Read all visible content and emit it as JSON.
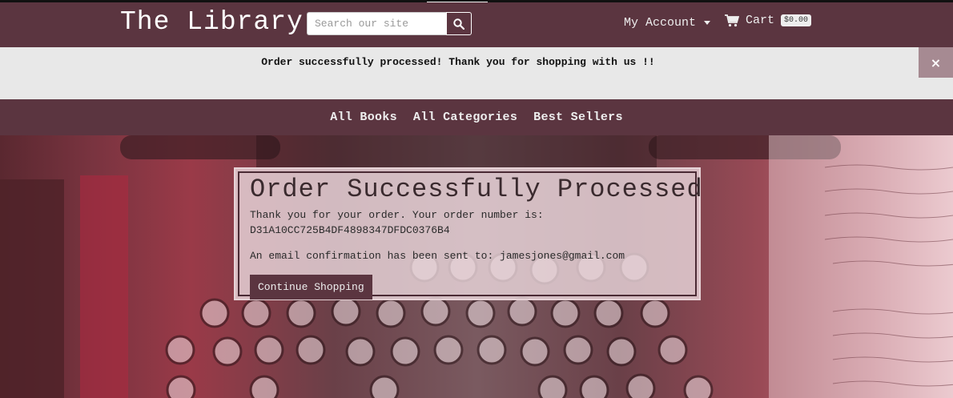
{
  "header": {
    "brand": "The Library",
    "search_placeholder": "Search our site",
    "account_label": "My Account",
    "cart_label": "Cart",
    "cart_total": "$0.00"
  },
  "alert": {
    "message": "Order successfully processed! Thank you for shopping with us !!",
    "close_label": "×"
  },
  "subnav": {
    "items": [
      "All Books",
      "All Categories",
      "Best Sellers"
    ]
  },
  "confirmation": {
    "title": "Order Successfully Processed",
    "thank_you": "Thank you for your order. Your order number is:",
    "order_number": "D31A10CC725B4DF4898347DFDC0376B4",
    "email_text": "An email confirmation has been sent to: jamesjones@gmail.com",
    "continue_label": "Continue Shopping"
  },
  "colors": {
    "brand": "#5b3540",
    "alert_bg": "#e8e8e8",
    "close_bg": "#a68a92"
  },
  "icons": {
    "search": "search-icon",
    "cart": "cart-icon",
    "caret": "chevron-down-icon",
    "close": "close-icon"
  }
}
